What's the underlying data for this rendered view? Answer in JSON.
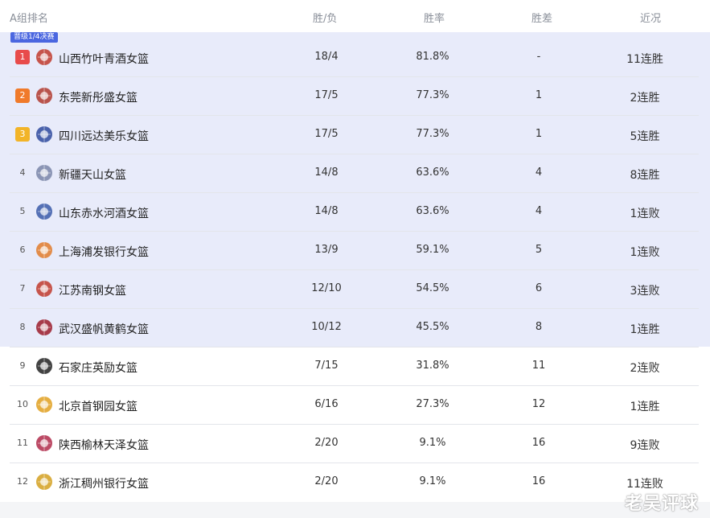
{
  "header": {
    "group": "A组排名",
    "win_loss": "胜/负",
    "win_pct": "胜率",
    "games_behind": "胜差",
    "recent": "近况"
  },
  "badge": "晋级1/4决赛",
  "colors": {
    "qualified_bg": "#e8ebfa",
    "badge": "#4a66e0",
    "rank1": "#e84b4b",
    "rank2": "#f07a2a",
    "rank3": "#f2b428"
  },
  "rows": [
    {
      "rank": "1",
      "team": "山西竹叶青酒女篮",
      "logo": "shanxi-logo-icon",
      "wl": "18/4",
      "pct": "81.8%",
      "gb": "-",
      "streak": "11连胜"
    },
    {
      "rank": "2",
      "team": "东莞新彤盛女篮",
      "logo": "dongguan-logo-icon",
      "wl": "17/5",
      "pct": "77.3%",
      "gb": "1",
      "streak": "2连胜"
    },
    {
      "rank": "3",
      "team": "四川远达美乐女篮",
      "logo": "sichuan-logo-icon",
      "wl": "17/5",
      "pct": "77.3%",
      "gb": "1",
      "streak": "5连胜"
    },
    {
      "rank": "4",
      "team": "新疆天山女篮",
      "logo": "xinjiang-logo-icon",
      "wl": "14/8",
      "pct": "63.6%",
      "gb": "4",
      "streak": "8连胜"
    },
    {
      "rank": "5",
      "team": "山东赤水河酒女篮",
      "logo": "shandong-logo-icon",
      "wl": "14/8",
      "pct": "63.6%",
      "gb": "4",
      "streak": "1连败"
    },
    {
      "rank": "6",
      "team": "上海浦发银行女篮",
      "logo": "shanghai-logo-icon",
      "wl": "13/9",
      "pct": "59.1%",
      "gb": "5",
      "streak": "1连败"
    },
    {
      "rank": "7",
      "team": "江苏南钢女篮",
      "logo": "jiangsu-logo-icon",
      "wl": "12/10",
      "pct": "54.5%",
      "gb": "6",
      "streak": "3连败"
    },
    {
      "rank": "8",
      "team": "武汉盛帆黄鹤女篮",
      "logo": "wuhan-logo-icon",
      "wl": "10/12",
      "pct": "45.5%",
      "gb": "8",
      "streak": "1连胜"
    },
    {
      "rank": "9",
      "team": "石家庄英励女篮",
      "logo": "shijiazhuang-logo-icon",
      "wl": "7/15",
      "pct": "31.8%",
      "gb": "11",
      "streak": "2连败"
    },
    {
      "rank": "10",
      "team": "北京首钢园女篮",
      "logo": "beijing-logo-icon",
      "wl": "6/16",
      "pct": "27.3%",
      "gb": "12",
      "streak": "1连胜"
    },
    {
      "rank": "11",
      "team": "陕西榆林天泽女篮",
      "logo": "shaanxi-logo-icon",
      "wl": "2/20",
      "pct": "9.1%",
      "gb": "16",
      "streak": "9连败"
    },
    {
      "rank": "12",
      "team": "浙江稠州银行女篮",
      "logo": "zhejiang-logo-icon",
      "wl": "2/20",
      "pct": "9.1%",
      "gb": "16",
      "streak": "11连败"
    }
  ],
  "watermark": "老吴评球"
}
